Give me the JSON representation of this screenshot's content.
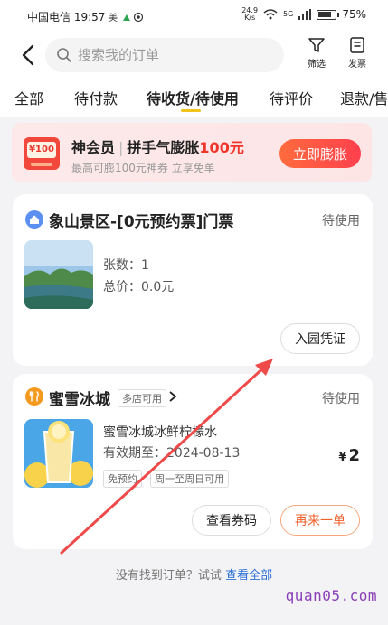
{
  "status_bar": {
    "carrier_time": "中国电信 19:57",
    "net_speed_top": "24.9",
    "net_speed_bottom": "K/s",
    "network": "5G",
    "battery": "75%"
  },
  "header": {
    "search_placeholder": "搜索我的订单",
    "filter_label": "筛选",
    "invoice_label": "发票"
  },
  "tabs": [
    {
      "label": "全部",
      "active": false
    },
    {
      "label": "待付款",
      "active": false
    },
    {
      "label": "待收货/待使用",
      "active": true
    },
    {
      "label": "待评价",
      "active": false
    },
    {
      "label": "退款/售",
      "active": false
    }
  ],
  "banner": {
    "coupon_value": "¥100",
    "title_part1": "神会员",
    "title_part2": "拼手气膨胀",
    "title_amount": "100元",
    "subtitle": "最高可膨100元神券 立享免单",
    "button": "立即膨胀"
  },
  "orders": [
    {
      "shop_name": "象山景区-[0元预约票]门票",
      "status": "待使用",
      "line1": "张数：1",
      "line2": "总价：0.0元",
      "actions": [
        "入园凭证"
      ]
    },
    {
      "shop_name": "蜜雪冰城",
      "shop_tag": "多店可用",
      "status": "待使用",
      "product": "蜜雪冰城冰鲜柠檬水",
      "validity": "有效期至：2024-08-13",
      "tags": [
        "免预约",
        "周一至周日可用"
      ],
      "price_symbol": "¥",
      "price": "2",
      "actions": [
        "查看券码",
        "再来一单"
      ]
    }
  ],
  "footer": {
    "text": "没有找到订单？试试",
    "link": "查看全部"
  },
  "watermark": "quan05.com",
  "colors": {
    "accent_yellow": "#f2c31d",
    "banner_red": "#f0352b",
    "link_blue": "#2b6fd6",
    "arrow_red": "#ef4a4a"
  }
}
